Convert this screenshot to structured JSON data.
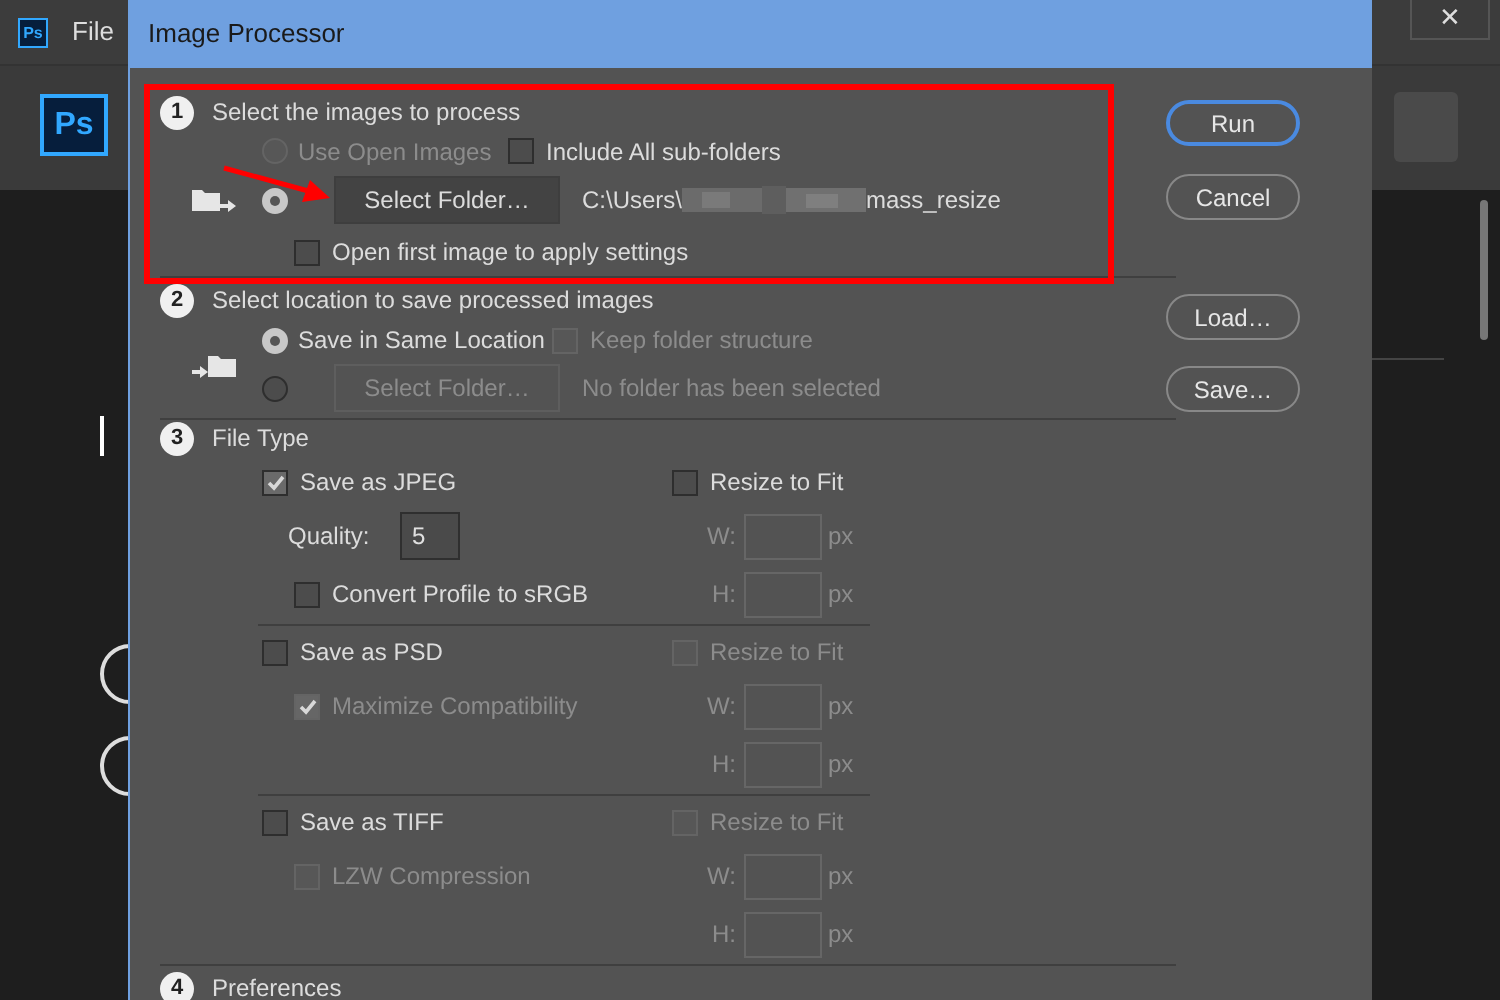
{
  "app": {
    "logo_small": "Ps",
    "menu": [
      "File"
    ],
    "logo_big": "Ps",
    "close_glyph": "✕"
  },
  "dialog": {
    "title": "Image Processor",
    "source": {
      "number": "1",
      "title": "Select the images to process",
      "highlighted": true,
      "use_open": {
        "label": "Use Open Images",
        "selected": false,
        "disabled": true
      },
      "include_sub": {
        "label": "Include All sub-folders",
        "checked": false
      },
      "folder_option": {
        "selected": true
      },
      "folder_button": {
        "label": "Select Folder…"
      },
      "path_start": "C:\\Users\\",
      "path_end": "mass_resize",
      "open_first": {
        "label": "Open first image to apply settings",
        "checked": false
      }
    },
    "destination": {
      "number": "2",
      "title": "Select location to save processed images",
      "same_location": {
        "label": "Save in Same Location",
        "selected": true
      },
      "keep_structure": {
        "label": "Keep folder structure",
        "checked": false,
        "disabled": true
      },
      "folder_option": {
        "selected": false
      },
      "folder_button": {
        "label": "Select Folder…",
        "disabled": true
      },
      "folder_status": {
        "text": "No folder has been selected",
        "disabled": true
      }
    },
    "file_type": {
      "number": "3",
      "title": "File Type",
      "formats": [
        {
          "save": {
            "label": "Save as JPEG",
            "checked": true
          },
          "resize": {
            "label": "Resize to Fit",
            "checked": false,
            "disabled": false
          },
          "options": [
            {
              "kind": "number",
              "label": "Quality:",
              "value": "5"
            },
            {
              "kind": "checkbox",
              "label": "Convert Profile to sRGB",
              "checked": false,
              "disabled": false
            }
          ],
          "width": {
            "label": "W:",
            "unit": "px",
            "disabled": true
          },
          "height": {
            "label": "H:",
            "unit": "px",
            "disabled": true
          }
        },
        {
          "save": {
            "label": "Save as PSD",
            "checked": false
          },
          "resize": {
            "label": "Resize to Fit",
            "checked": false,
            "disabled": true
          },
          "options": [
            {
              "kind": "checkbox",
              "label": "Maximize Compatibility",
              "checked": true,
              "disabled": true
            }
          ],
          "width": {
            "label": "W:",
            "unit": "px",
            "disabled": true
          },
          "height": {
            "label": "H:",
            "unit": "px",
            "disabled": true
          }
        },
        {
          "save": {
            "label": "Save as TIFF",
            "checked": false
          },
          "resize": {
            "label": "Resize to Fit",
            "checked": false,
            "disabled": true
          },
          "options": [
            {
              "kind": "checkbox",
              "label": "LZW Compression",
              "checked": false,
              "disabled": true
            }
          ],
          "width": {
            "label": "W:",
            "unit": "px",
            "disabled": true
          },
          "height": {
            "label": "H:",
            "unit": "px",
            "disabled": true
          }
        }
      ]
    },
    "preferences": {
      "number": "4",
      "title": "Preferences"
    },
    "buttons": [
      {
        "label": "Run",
        "focused": true
      },
      {
        "label": "Cancel",
        "focused": false
      },
      {
        "label": "Load…",
        "focused": false
      },
      {
        "label": "Save…",
        "focused": false
      }
    ]
  }
}
